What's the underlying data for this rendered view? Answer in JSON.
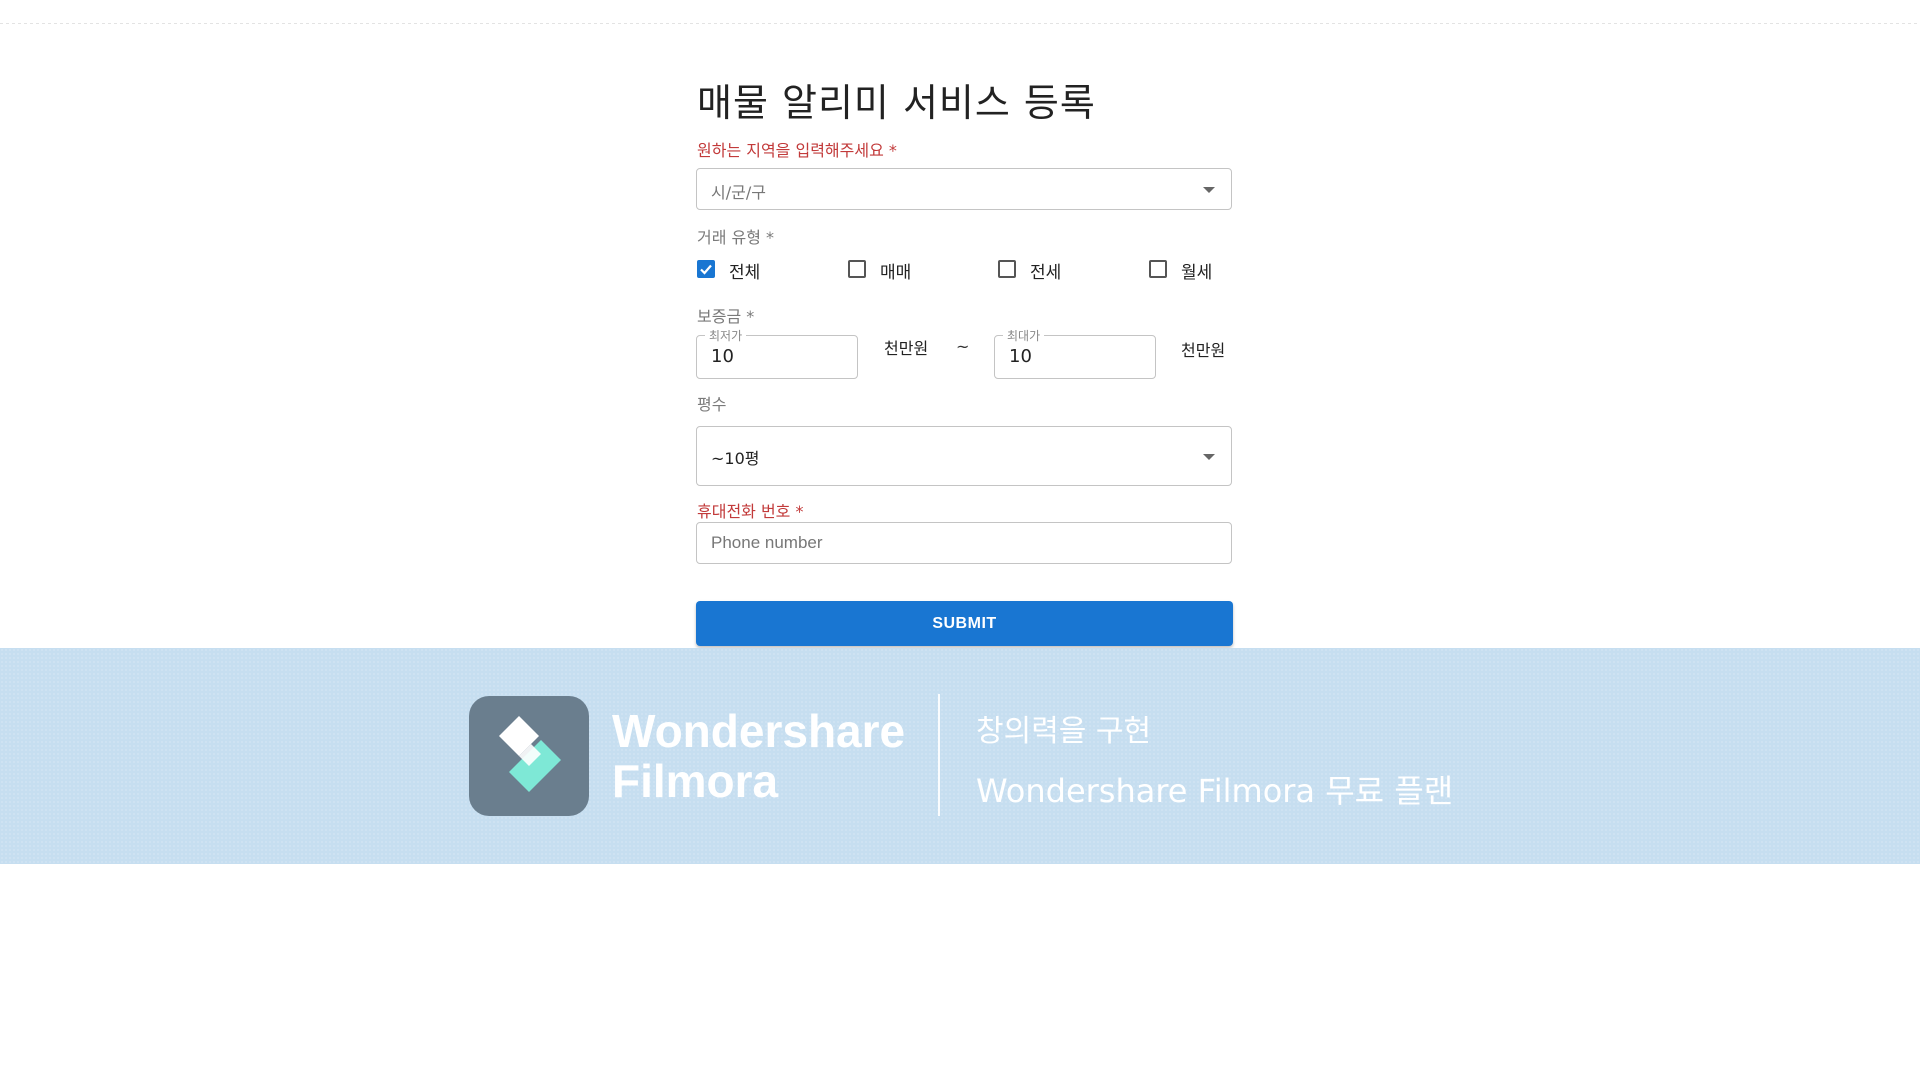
{
  "form": {
    "title": "매물 알리미 서비스 등록",
    "region": {
      "label": "원하는 지역을 입력해주세요 *",
      "selected": "시/군/구"
    },
    "trade_type": {
      "label": "거래 유형 *",
      "options": [
        {
          "label": "전체",
          "checked": true
        },
        {
          "label": "매매",
          "checked": false
        },
        {
          "label": "전세",
          "checked": false
        },
        {
          "label": "월세",
          "checked": false
        }
      ]
    },
    "deposit": {
      "label": "보증금 *",
      "min_legend": "최저가",
      "min_value": "10",
      "min_unit": "천만원",
      "separator": "~",
      "max_legend": "최대가",
      "max_value": "10",
      "max_unit": "천만원"
    },
    "area": {
      "label": "평수",
      "selected": "~10평"
    },
    "phone": {
      "label": "휴대전화 번호 *",
      "placeholder": "Phone number"
    },
    "submit_label": "SUBMIT"
  },
  "watermark": {
    "brand_line1": "Wondershare",
    "brand_line2": "Filmora",
    "tagline": "창의력을 구현",
    "plan": "Wondershare Filmora 무료 플랜"
  },
  "colors": {
    "accent": "#1976d2",
    "required_label": "#c23a3a",
    "banner_bg": "#c6def0"
  }
}
